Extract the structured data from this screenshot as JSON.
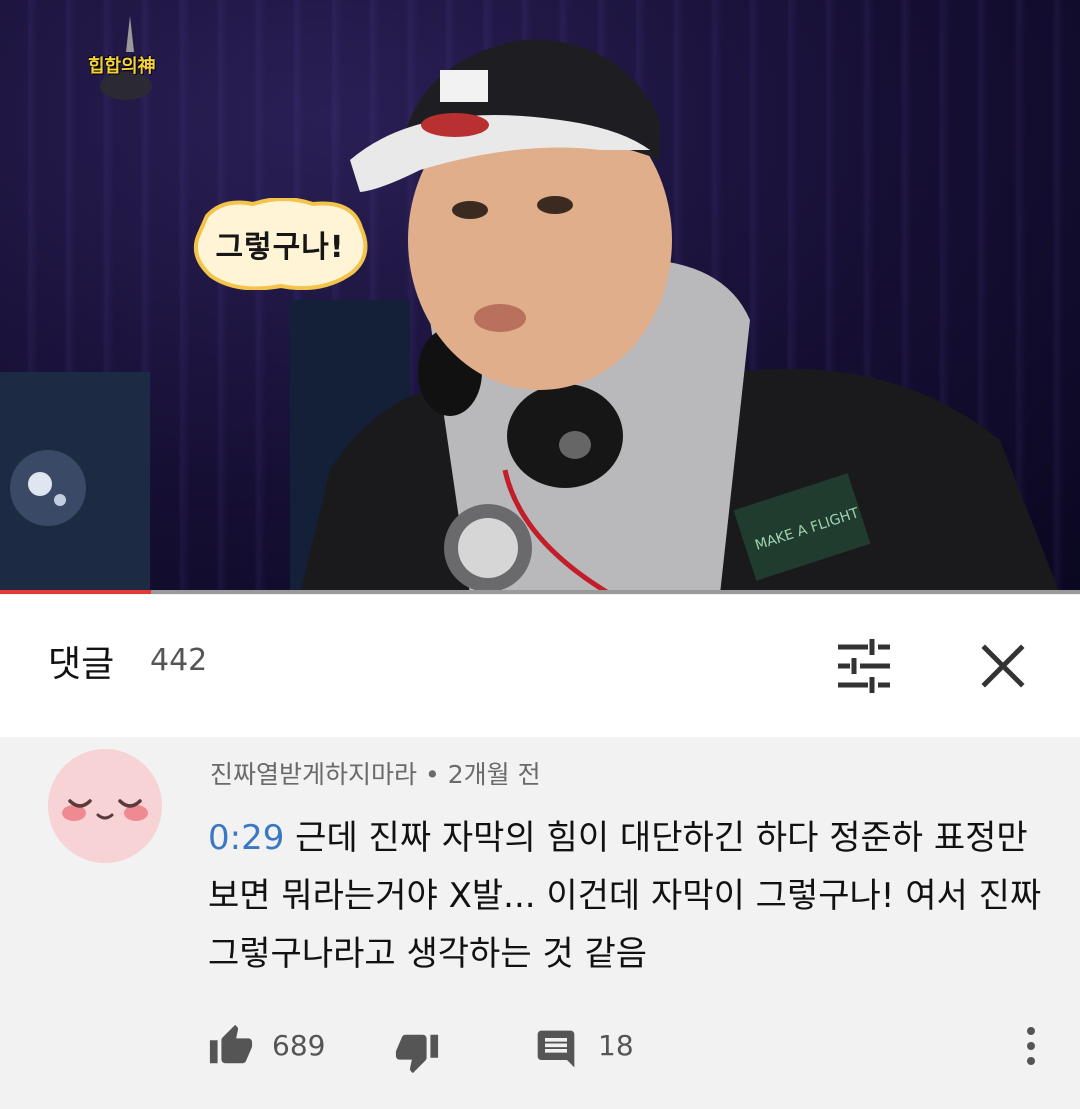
{
  "video": {
    "show_logo_text": "힙합의神",
    "caption": "그렇구나!",
    "patch_text": "MAKE A FLIGHT",
    "progress": 0.14
  },
  "comments_header": {
    "title": "댓글",
    "count": "442",
    "filter_icon": "sort-filter-icon",
    "close_icon": "close-icon"
  },
  "comment": {
    "author": "진짜열받게하지마라",
    "separator": "•",
    "time": "2개월 전",
    "timestamp": "0:29",
    "text": " 근데 진짜 자막의 힘이 대단하긴 하다 정준하 표정만 보면 뭐라는거야 X발... 이건데 자막이 그렇구나! 여서 진짜 그렇구나라고 생각하는 것 같음",
    "likes": "689",
    "replies": "18",
    "icons": {
      "like": "thumbs-up-icon",
      "dislike": "thumbs-down-icon",
      "reply": "reply-icon",
      "more": "more-vert-icon"
    }
  },
  "colors": {
    "progress": "#e53935",
    "timestamp_link": "#3b78c4",
    "avatar_bg": "#f7d3d6",
    "comment_bg": "#f2f2f2"
  }
}
